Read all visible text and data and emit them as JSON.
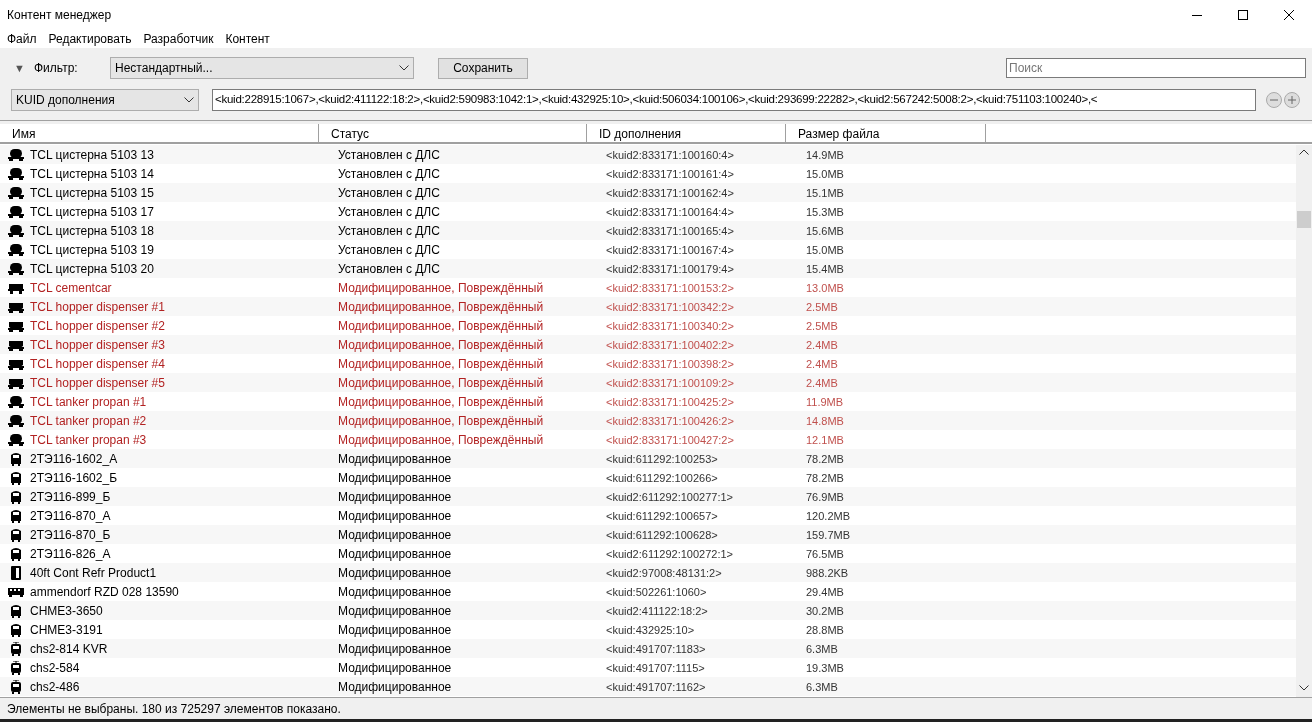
{
  "window": {
    "title": "Контент менеджер"
  },
  "menu": [
    "Файл",
    "Редактировать",
    "Разработчик",
    "Контент"
  ],
  "filter": {
    "toggle": "▼",
    "label": "Фильтр:",
    "value": "Нестандартный...",
    "save": "Сохранить",
    "search_placeholder": "Поиск"
  },
  "condition": {
    "field": "KUID дополнения",
    "value": "<kuid:228915:1067>,<kuid2:411122:18:2>,<kuid2:590983:1042:1>,<kuid:432925:10>,<kuid:506034:100106>,<kuid:293699:22282>,<kuid2:567242:5008:2>,<kuid:751103:100240>,<"
  },
  "table": {
    "columns": [
      "Имя",
      "Статус",
      "ID дополнения",
      "Размер файла"
    ],
    "rows": [
      {
        "kind": "tank",
        "name": "TCL цистерна 5103 13",
        "status": "Установлен с ДЛС",
        "id": "<kuid2:833171:100160:4>",
        "size": "14.9MB",
        "damaged": false
      },
      {
        "kind": "tank",
        "name": "TCL цистерна 5103 14",
        "status": "Установлен с ДЛС",
        "id": "<kuid2:833171:100161:4>",
        "size": "15.0MB",
        "damaged": false
      },
      {
        "kind": "tank",
        "name": "TCL цистерна 5103 15",
        "status": "Установлен с ДЛС",
        "id": "<kuid2:833171:100162:4>",
        "size": "15.1MB",
        "damaged": false
      },
      {
        "kind": "tank",
        "name": "TCL цистерна 5103 17",
        "status": "Установлен с ДЛС",
        "id": "<kuid2:833171:100164:4>",
        "size": "15.3MB",
        "damaged": false
      },
      {
        "kind": "tank",
        "name": "TCL цистерна 5103 18",
        "status": "Установлен с ДЛС",
        "id": "<kuid2:833171:100165:4>",
        "size": "15.6MB",
        "damaged": false
      },
      {
        "kind": "tank",
        "name": "TCL цистерна 5103 19",
        "status": "Установлен с ДЛС",
        "id": "<kuid2:833171:100167:4>",
        "size": "15.0MB",
        "damaged": false
      },
      {
        "kind": "tank",
        "name": "TCL цистерна 5103 20",
        "status": "Установлен с ДЛС",
        "id": "<kuid2:833171:100179:4>",
        "size": "15.4MB",
        "damaged": false
      },
      {
        "kind": "flatcar",
        "name": "TCL cementcar",
        "status": "Модифицированное, Повреждённый",
        "id": "<kuid2:833171:100153:2>",
        "size": "13.0MB",
        "damaged": true
      },
      {
        "kind": "hopper",
        "name": "TCL hopper dispenser #1",
        "status": "Модифицированное, Повреждённый",
        "id": "<kuid2:833171:100342:2>",
        "size": "2.5MB",
        "damaged": true
      },
      {
        "kind": "hopper",
        "name": "TCL hopper dispenser #2",
        "status": "Модифицированное, Повреждённый",
        "id": "<kuid2:833171:100340:2>",
        "size": "2.5MB",
        "damaged": true
      },
      {
        "kind": "hopper",
        "name": "TCL hopper dispenser #3",
        "status": "Модифицированное, Повреждённый",
        "id": "<kuid2:833171:100402:2>",
        "size": "2.4MB",
        "damaged": true
      },
      {
        "kind": "hopper",
        "name": "TCL hopper dispenser #4",
        "status": "Модифицированное, Повреждённый",
        "id": "<kuid2:833171:100398:2>",
        "size": "2.4MB",
        "damaged": true
      },
      {
        "kind": "hopper",
        "name": "TCL hopper dispenser #5",
        "status": "Модифицированное, Повреждённый",
        "id": "<kuid2:833171:100109:2>",
        "size": "2.4MB",
        "damaged": true
      },
      {
        "kind": "tank",
        "name": "TCL tanker propan #1",
        "status": "Модифицированное, Повреждённый",
        "id": "<kuid2:833171:100425:2>",
        "size": "11.9MB",
        "damaged": true
      },
      {
        "kind": "tank",
        "name": "TCL tanker propan #2",
        "status": "Модифицированное, Повреждённый",
        "id": "<kuid2:833171:100426:2>",
        "size": "14.8MB",
        "damaged": true
      },
      {
        "kind": "tank",
        "name": "TCL tanker propan #3",
        "status": "Модифицированное, Повреждённый",
        "id": "<kuid2:833171:100427:2>",
        "size": "12.1MB",
        "damaged": true
      },
      {
        "kind": "locomotive",
        "name": "2ТЭ116-1602_А",
        "status": "Модифицированное",
        "id": "<kuid:611292:100253>",
        "size": "78.2MB",
        "damaged": false
      },
      {
        "kind": "locomotive",
        "name": "2ТЭ116-1602_Б",
        "status": "Модифицированное",
        "id": "<kuid:611292:100266>",
        "size": "78.2MB",
        "damaged": false
      },
      {
        "kind": "locomotive",
        "name": "2ТЭ116-899_Б",
        "status": "Модифицированное",
        "id": "<kuid2:611292:100277:1>",
        "size": "76.9MB",
        "damaged": false
      },
      {
        "kind": "locomotive",
        "name": "2ТЭ116-870_А",
        "status": "Модифицированное",
        "id": "<kuid:611292:100657>",
        "size": "120.2MB",
        "damaged": false
      },
      {
        "kind": "locomotive",
        "name": "2ТЭ116-870_Б",
        "status": "Модифицированное",
        "id": "<kuid:611292:100628>",
        "size": "159.7MB",
        "damaged": false
      },
      {
        "kind": "locomotive",
        "name": "2ТЭ116-826_А",
        "status": "Модифицированное",
        "id": "<kuid2:611292:100272:1>",
        "size": "76.5MB",
        "damaged": false
      },
      {
        "kind": "container",
        "name": "40ft Cont Refr Product1",
        "status": "Модифицированное",
        "id": "<kuid2:97008:48131:2>",
        "size": "988.2KB",
        "damaged": false
      },
      {
        "kind": "coach",
        "name": "ammendorf RZD 028 13590",
        "status": "Модифицированное",
        "id": "<kuid:502261:1060>",
        "size": "29.4MB",
        "damaged": false
      },
      {
        "kind": "locomotive",
        "name": "CHME3-3650",
        "status": "Модифицированное",
        "id": "<kuid2:411122:18:2>",
        "size": "30.2MB",
        "damaged": false
      },
      {
        "kind": "locomotive",
        "name": "CHME3-3191",
        "status": "Модифицированное",
        "id": "<kuid:432925:10>",
        "size": "28.8MB",
        "damaged": false
      },
      {
        "kind": "electric",
        "name": "chs2-814 KVR",
        "status": "Модифицированное",
        "id": "<kuid:491707:1183>",
        "size": "6.3MB",
        "damaged": false
      },
      {
        "kind": "electric",
        "name": "chs2-584",
        "status": "Модифицированное",
        "id": "<kuid:491707:1115>",
        "size": "19.3MB",
        "damaged": false
      },
      {
        "kind": "electric",
        "name": "chs2-486",
        "status": "Модифицированное",
        "id": "<kuid:491707:1162>",
        "size": "6.3MB",
        "damaged": false
      }
    ]
  },
  "status_bar": "Элементы не выбраны. 180 из 725297 элементов показано."
}
